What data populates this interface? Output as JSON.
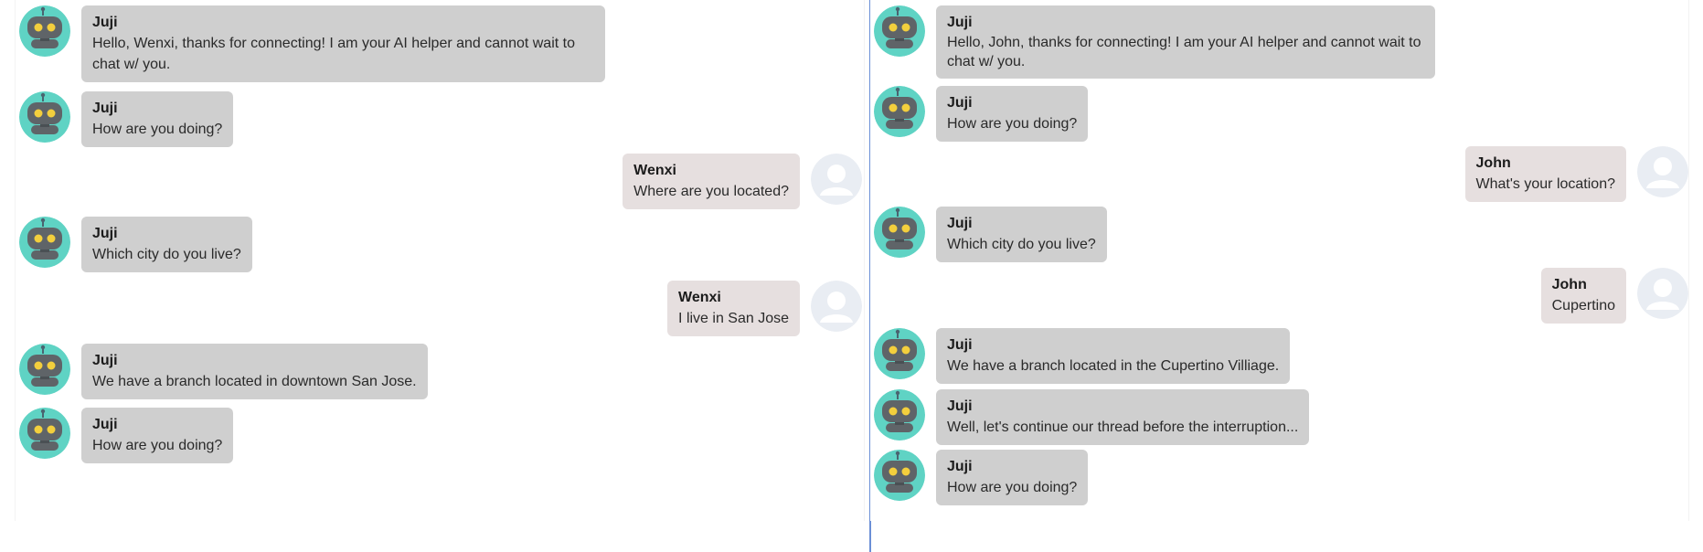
{
  "left": {
    "messages": [
      {
        "role": "bot",
        "sender": "Juji",
        "text": "Hello, Wenxi, thanks for connecting! I am your AI helper and cannot wait to chat w/ you."
      },
      {
        "role": "bot",
        "sender": "Juji",
        "text": "How are you doing?"
      },
      {
        "role": "user",
        "sender": "Wenxi",
        "text": "Where are you located?"
      },
      {
        "role": "bot",
        "sender": "Juji",
        "text": "Which city do you live?"
      },
      {
        "role": "user",
        "sender": "Wenxi",
        "text": "I live in San Jose"
      },
      {
        "role": "bot",
        "sender": "Juji",
        "text": "We have a branch located in downtown San Jose."
      },
      {
        "role": "bot",
        "sender": "Juji",
        "text": "How are you doing?"
      }
    ]
  },
  "right": {
    "messages": [
      {
        "role": "bot",
        "sender": "Juji",
        "text": "Hello, John, thanks for connecting! I am your AI helper and cannot wait to chat w/ you."
      },
      {
        "role": "bot",
        "sender": "Juji",
        "text": "How are you doing?"
      },
      {
        "role": "user",
        "sender": "John",
        "text": "What's your location?"
      },
      {
        "role": "bot",
        "sender": "Juji",
        "text": "Which city do you live?"
      },
      {
        "role": "user",
        "sender": "John",
        "text": "Cupertino"
      },
      {
        "role": "bot",
        "sender": "Juji",
        "text": "We have a branch located in the Cupertino Villiage."
      },
      {
        "role": "bot",
        "sender": "Juji",
        "text": "Well, let's continue our thread before the interruption..."
      },
      {
        "role": "bot",
        "sender": "Juji",
        "text": "How are you doing?"
      }
    ]
  },
  "colors": {
    "bot_bubble": "#cfcfcf",
    "user_bubble": "#e6dfdf",
    "bot_avatar_bg": "#5fd3c4",
    "divider": "#6b8fd6"
  },
  "icons": {
    "bot_avatar": "robot-avatar-icon",
    "user_avatar": "user-silhouette-icon"
  }
}
